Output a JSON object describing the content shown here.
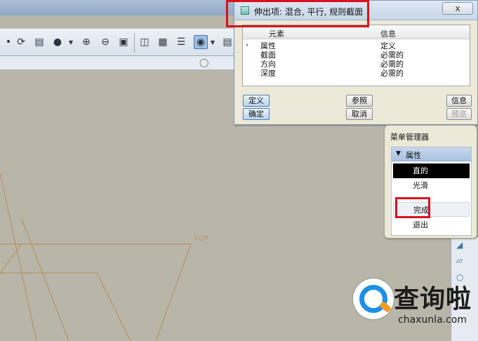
{
  "dialog": {
    "title": "伸出项: 混合, 平行, 规则截面",
    "close_label": "x",
    "columns": {
      "element": "元素",
      "info": "信息"
    },
    "rows": [
      {
        "element": "属性",
        "info": "定义"
      },
      {
        "element": "截面",
        "info": "必需的"
      },
      {
        "element": "方向",
        "info": "必需的"
      },
      {
        "element": "深度",
        "info": "必需的"
      }
    ],
    "buttons": {
      "define": "定义",
      "reference": "参照",
      "info": "信息",
      "ok": "确定",
      "cancel": "取消",
      "preview": "预览"
    }
  },
  "menu_manager": {
    "title": "菜单管理器",
    "section": "属性",
    "items": [
      {
        "label": "直的"
      },
      {
        "label": "光滑"
      },
      {
        "label": "完成"
      },
      {
        "label": "退出"
      }
    ]
  },
  "graphics": {
    "plane_label": "TOP"
  },
  "toolbar": {
    "icons": [
      "sketch-icon",
      "regenerate-icon",
      "shading-icon",
      "sphere-icon",
      "zoom-in-icon",
      "zoom-out-icon",
      "refit-icon",
      "datum-plane-icon",
      "annotation-icon",
      "layers-icon",
      "blend-icon",
      "table-icon"
    ]
  },
  "watermark": {
    "name": "查询啦",
    "url": "chaxunla.com"
  },
  "colors": {
    "highlight": "#d8121d",
    "sketch_line": "#b39565",
    "graphics_bg": "#b9b6a9",
    "selected_item": "#000000"
  }
}
